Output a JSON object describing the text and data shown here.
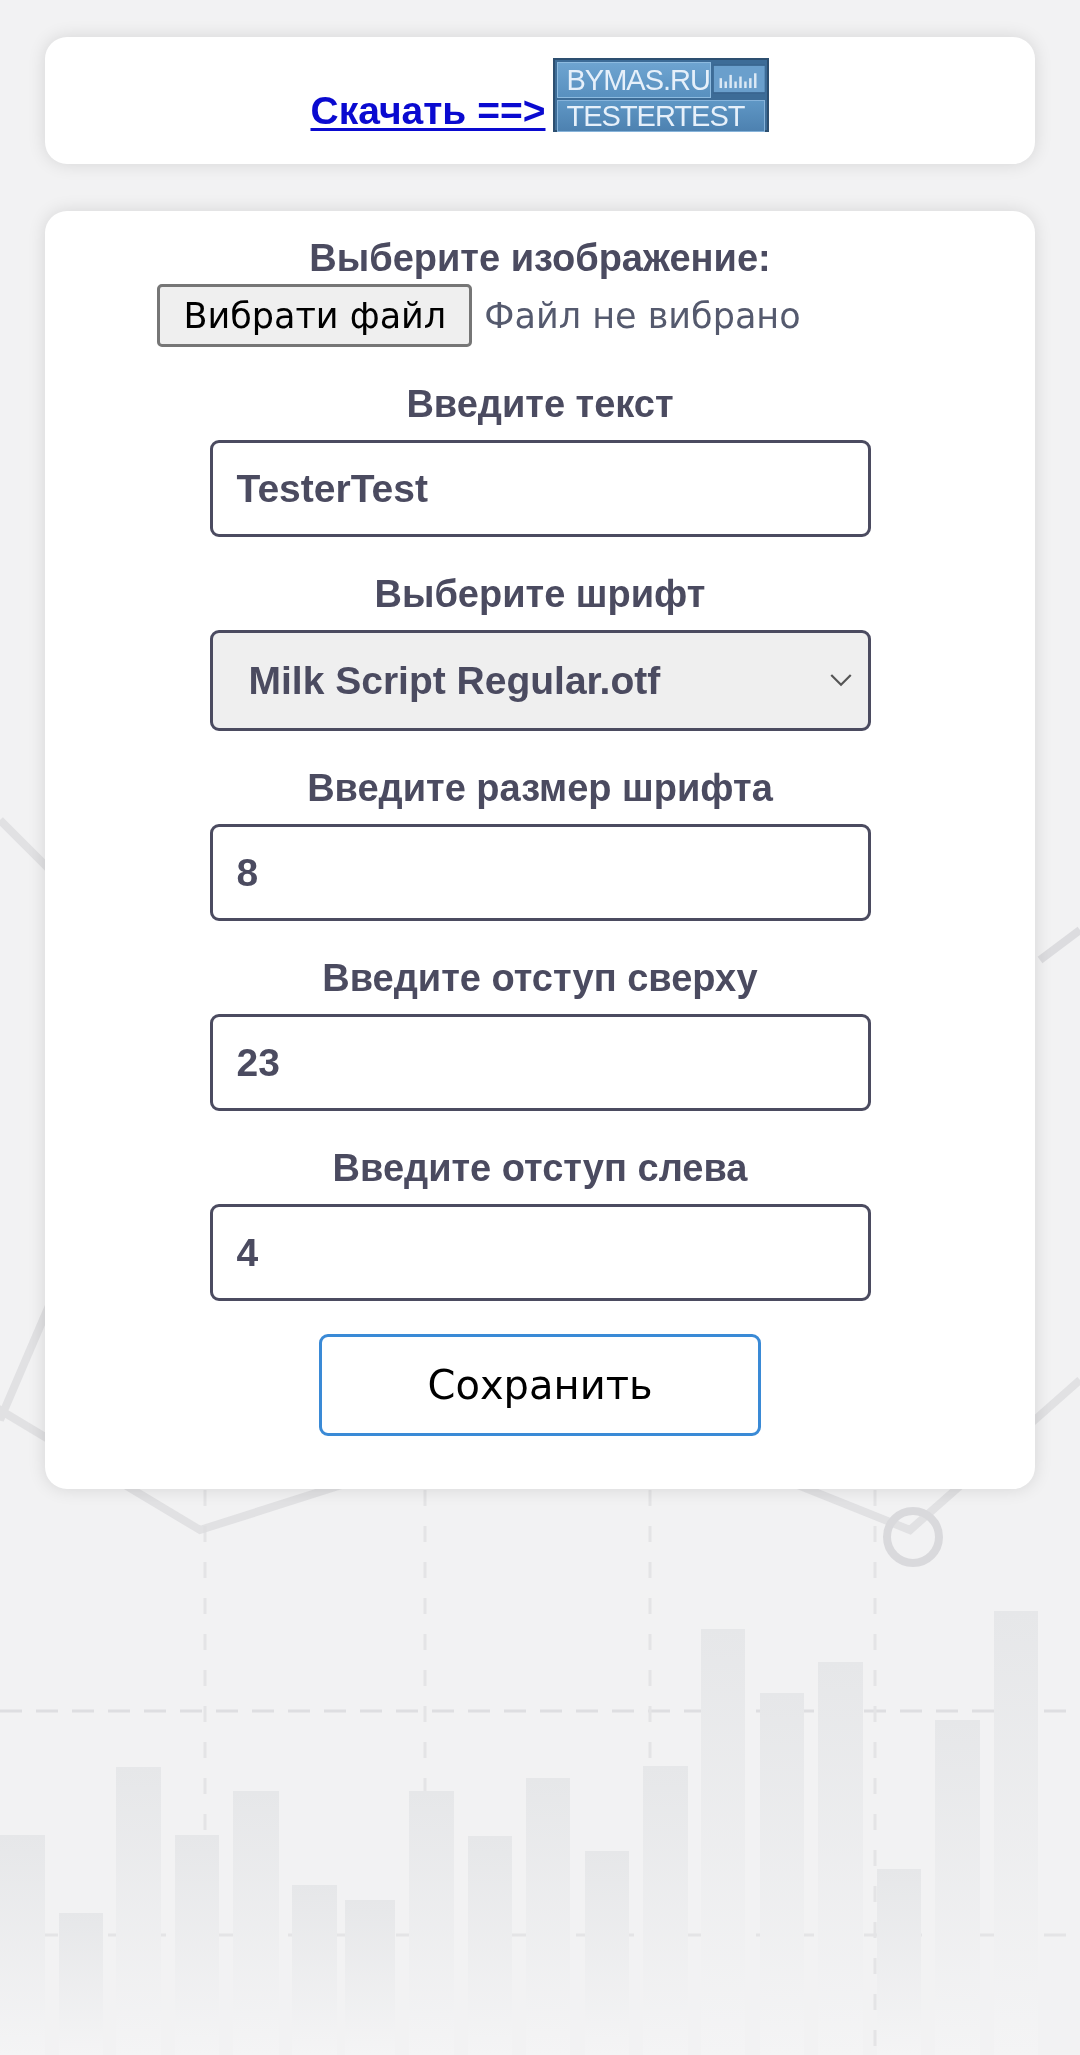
{
  "header": {
    "download_link": "Скачать ==>",
    "banner": {
      "line_1": "BYMAS.RU",
      "line_2": "TESTERTEST"
    }
  },
  "form": {
    "file": {
      "label": "Выберите изображение:",
      "button": "Вибрати файл",
      "status": "Файл не вибрано"
    },
    "fields": [
      {
        "kind": "text",
        "label": "Введите текст",
        "value": "TesterTest"
      },
      {
        "kind": "select",
        "label": "Выберите шрифт",
        "value": "Milk Script Regular.otf"
      },
      {
        "kind": "text",
        "label": "Введите размер шрифта",
        "value": "8"
      },
      {
        "kind": "text",
        "label": "Введите отступ сверху",
        "value": "23"
      },
      {
        "kind": "text",
        "label": "Введите отступ слева",
        "value": "4"
      }
    ],
    "submit": "Сохранить"
  }
}
